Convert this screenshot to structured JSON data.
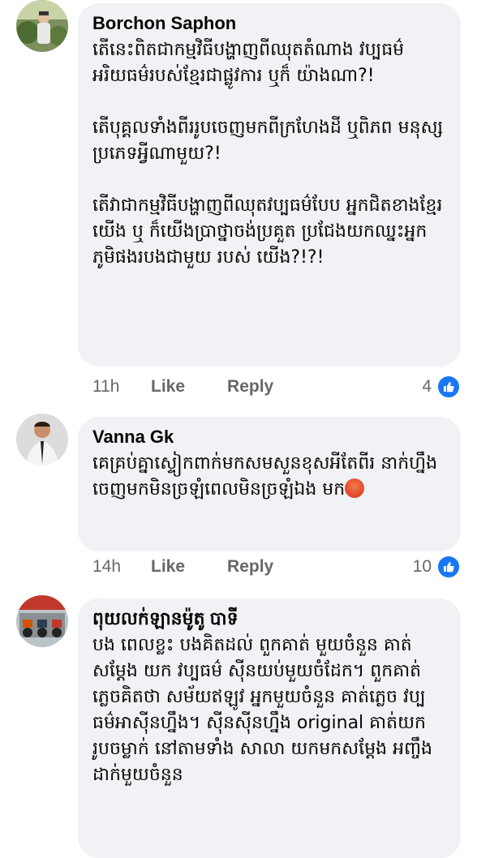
{
  "comments": [
    {
      "author": "Borchon Saphon",
      "paragraphs": [
        "តើនេះពិតជាកម្មវិធីបង្ហាញពីឈុតតំណាង វប្បធម៌អរិយធម៌របស់ខ្មែរជាផ្លូវការ ឬក៏ យ៉ាងណា?!",
        "តើបុគ្គលទាំងពីររូបចេញមកពីក្រហែងដី ឬពិភព មនុស្សប្រភេទអ្វីណាមួយ?!",
        "តើវាជាកម្មវិធីបង្ហាញពីឈុតវប្បធម៌បែប អ្នកជិតខាងខ្មែរយើង ឬ ក៏យើងប្រាថ្នាចង់ប្រគួត ប្រជែងយកឈ្នះអ្នកភូមិផងរបងជាមួយ របស់ យើង?!?!"
      ],
      "time": "11h",
      "like_label": "Like",
      "reply_label": "Reply",
      "reaction_count": "4"
    },
    {
      "author": "Vanna Gk",
      "paragraphs": [
        "គេគ្រប់គ្នាស្ទៀកពាក់មកសមសួនខុសអីតែពីរ នាក់ហ្នឹងចេញមកមិនច្រឡំពេលមិនច្រឡំឯង មក"
      ],
      "time": "14h",
      "like_label": "Like",
      "reply_label": "Reply",
      "reaction_count": "10",
      "emoji": "angry-face"
    },
    {
      "author": "ពុយលក់ឡានម៉ូតូ បាទី",
      "paragraphs": [
        "បង ពេលខ្លះ បងគិតដល់ ពួកគាត់ មួយចំនួន គាត់សម្ដែង យក វប្បធម៌ ស៊ីនយប់មួយចំដែក។ ពួកគាត់ភ្លេចគិតថា សម័យឥឡូវ អ្នកមួយចំនួន គាត់ភ្លេច វប្បធម៌អាស៊ីនហ្នឹង។ ស៊ីនស៊ីនហ្នឹង original គាត់យក រូបចម្លាក់ នៅតាមទាំង សាលា យកមកសម្ដែង អញ្ចឹង ដាក់មួយចំនួន"
      ]
    }
  ],
  "colors": {
    "bubble": "#f0f2f5",
    "meta_text": "#65676b",
    "like_blue": "#1877f2"
  },
  "icons": [
    "avatar-photo",
    "like-thumb-icon",
    "angry-face-emoji"
  ]
}
